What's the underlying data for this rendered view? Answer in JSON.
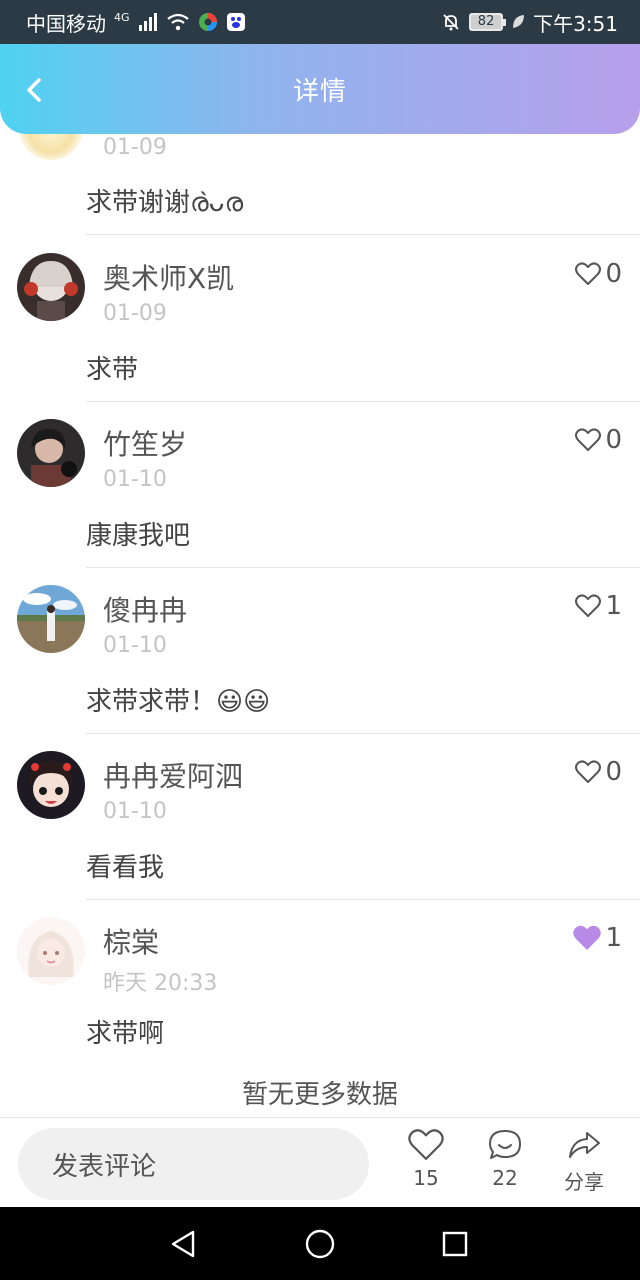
{
  "status_bar": {
    "carrier": "中国移动",
    "network": "4G",
    "battery": "82",
    "time": "下午3:51"
  },
  "header": {
    "title": "详情"
  },
  "partial_comment": {
    "date": "01-09",
    "text": "求带谢谢ര̀ᴗര"
  },
  "comments": [
    {
      "name": "奥术师X凯",
      "date": "01-09",
      "text": "求带",
      "likes": "0",
      "liked": false,
      "avatar": "avatar-red-headphones"
    },
    {
      "name": "竹笙岁",
      "date": "01-10",
      "text": "康康我吧",
      "likes": "0",
      "liked": false,
      "avatar": "avatar-dark-portrait"
    },
    {
      "name": "傻冉冉",
      "date": "01-10",
      "text": "求带求带！😃😃",
      "likes": "1",
      "liked": false,
      "avatar": "avatar-landscape"
    },
    {
      "name": "冉冉爱阿泗",
      "date": "01-10",
      "text": "看看我",
      "likes": "0",
      "liked": false,
      "avatar": "avatar-cartoon-girl"
    },
    {
      "name": "棕棠",
      "date": "昨天 20:33",
      "text": "求带啊",
      "likes": "1",
      "liked": true,
      "avatar": "avatar-pastel-girl"
    }
  ],
  "no_more": "暂无更多数据",
  "bottom": {
    "input_placeholder": "发表评论",
    "like_count": "15",
    "comment_count": "22",
    "share_label": "分享"
  },
  "colors": {
    "liked": "#b78ae8",
    "header_start": "#4fd2f0",
    "header_end": "#b79fec"
  }
}
